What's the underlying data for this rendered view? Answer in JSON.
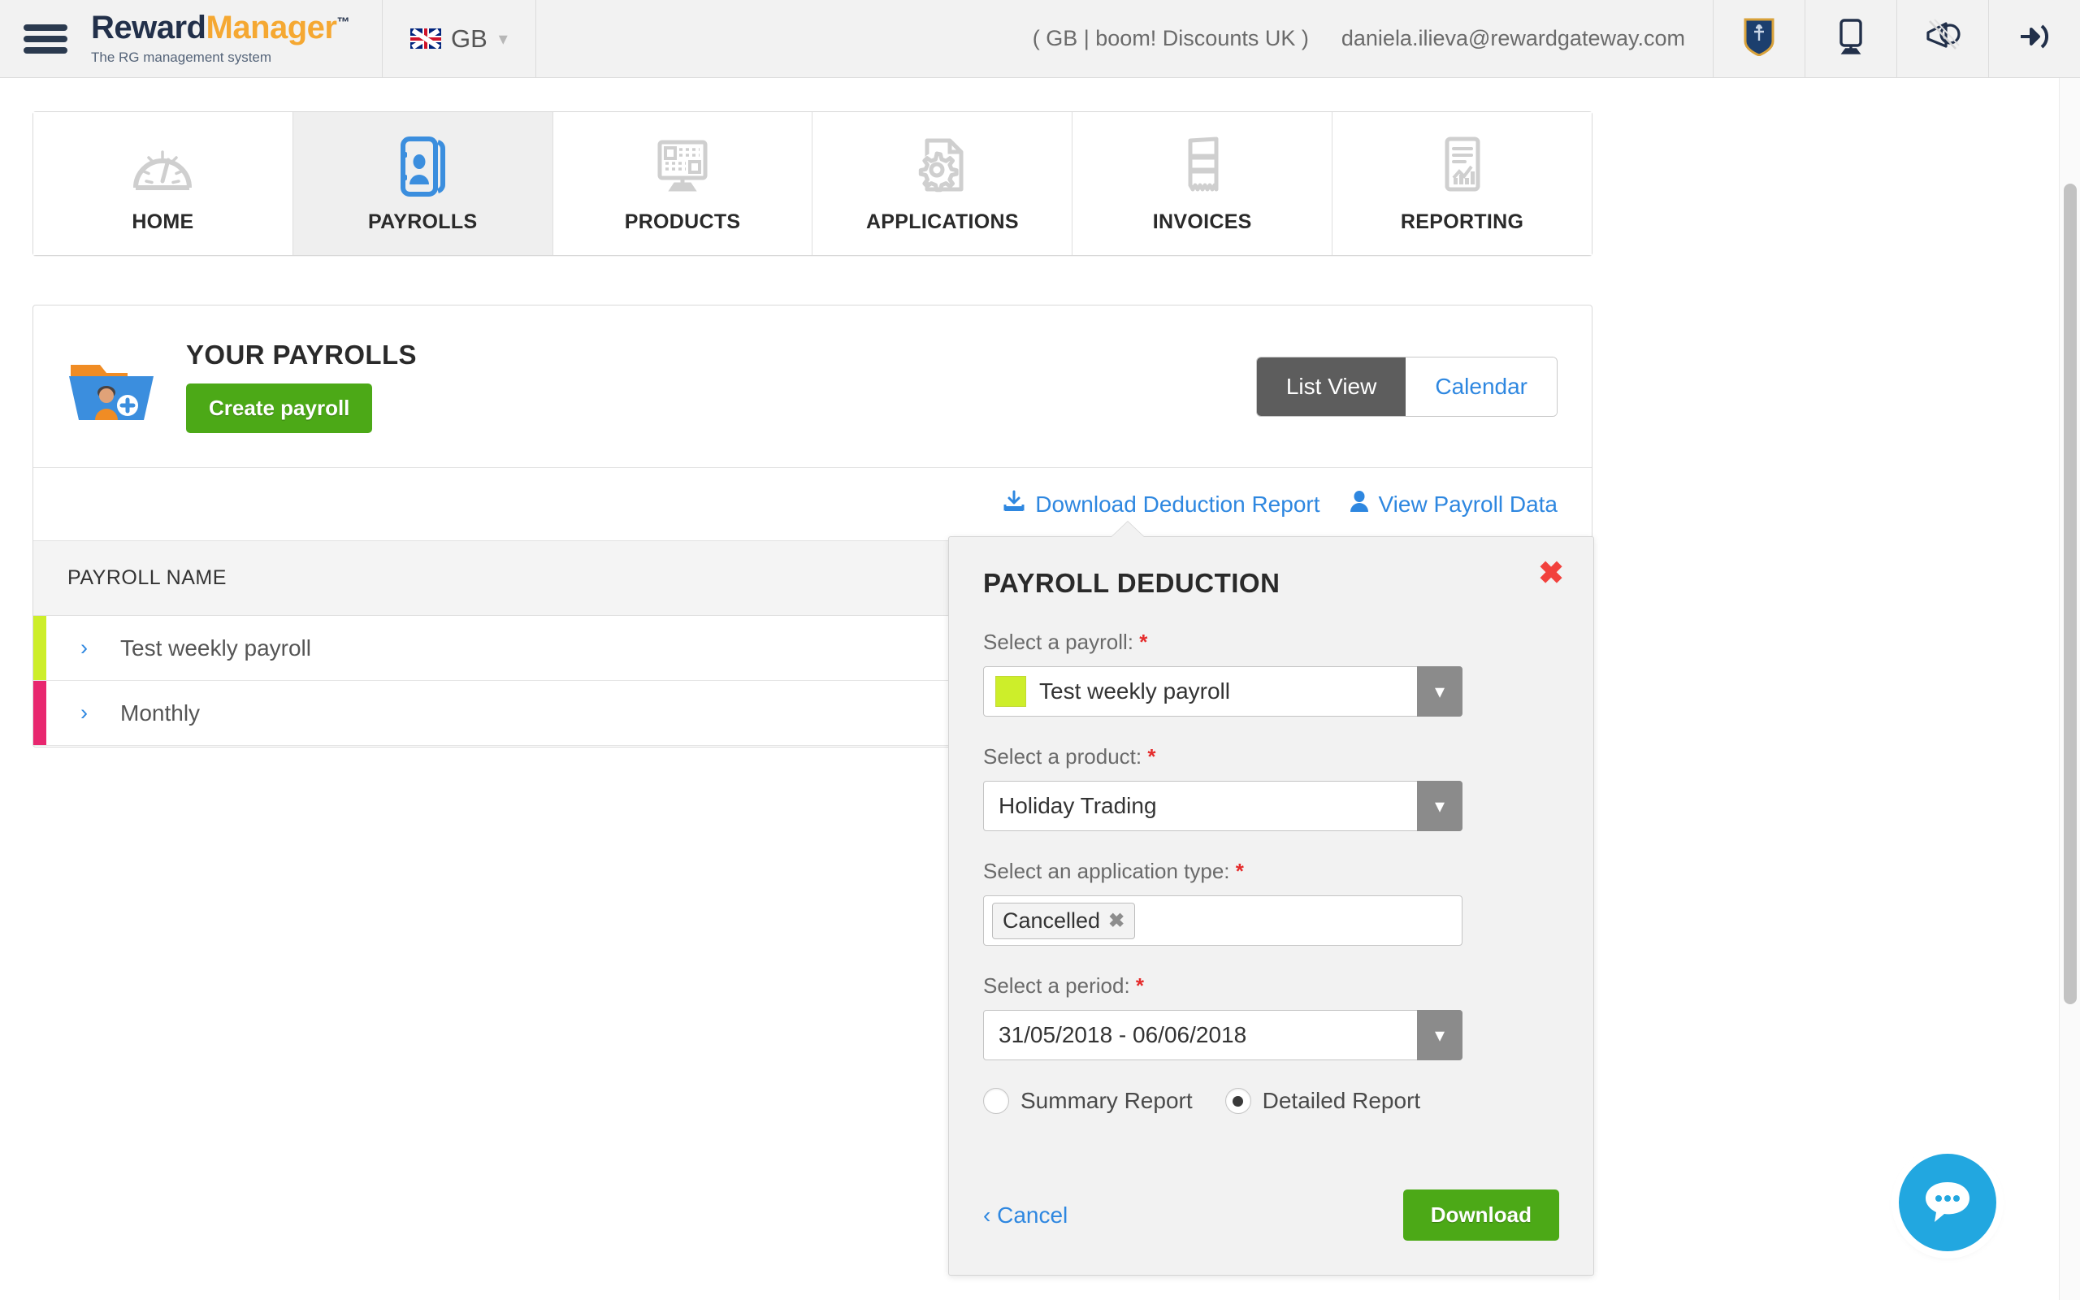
{
  "header": {
    "menu_icon": "hamburger-icon",
    "brand_part1": "Reward",
    "brand_part2": "Manager",
    "brand_tm": "™",
    "brand_tagline": "The RG management system",
    "locale_label": "GB",
    "locale_flag": "uk-flag-icon",
    "context": "( GB | boom! Discounts UK )",
    "user_email": "daniela.ilieva@rewardgateway.com",
    "icons": [
      {
        "name": "shield-icon"
      },
      {
        "name": "monitor-icon"
      },
      {
        "name": "megaphone-icon"
      },
      {
        "name": "logout-icon"
      }
    ]
  },
  "nav": {
    "tabs": [
      {
        "label": "HOME",
        "icon": "speedometer-icon",
        "active": false
      },
      {
        "label": "PAYROLLS",
        "icon": "id-card-icon",
        "active": true
      },
      {
        "label": "PRODUCTS",
        "icon": "monitor-grid-icon",
        "active": false
      },
      {
        "label": "APPLICATIONS",
        "icon": "gear-document-icon",
        "active": false
      },
      {
        "label": "INVOICES",
        "icon": "receipt-icon",
        "active": false
      },
      {
        "label": "REPORTING",
        "icon": "report-chart-icon",
        "active": false
      }
    ]
  },
  "payrolls_card": {
    "folder_icon": "folder-user-icon",
    "title": "YOUR PAYROLLS",
    "create_button": "Create payroll",
    "view_toggle": {
      "list_view": "List View",
      "calendar": "Calendar",
      "selected": "List View"
    },
    "links": [
      {
        "label": "Download Deduction Report",
        "icon": "download-icon"
      },
      {
        "label": "View Payroll Data",
        "icon": "person-icon"
      }
    ],
    "table": {
      "columns": [
        "PAYROLL NAME"
      ],
      "rows": [
        {
          "name": "Test weekly payroll",
          "color": "#cdee2a",
          "chevron": "›"
        },
        {
          "name": "Monthly",
          "color": "#e8276f",
          "chevron": "›"
        }
      ]
    }
  },
  "popover": {
    "title": "PAYROLL DEDUCTION",
    "close_icon": "close-icon",
    "fields": {
      "payroll": {
        "label": "Select a payroll:",
        "required": "*",
        "value": "Test weekly payroll",
        "swatch_color": "#cdee2a"
      },
      "product": {
        "label": "Select a product:",
        "required": "*",
        "value": "Holiday Trading"
      },
      "application_type": {
        "label": "Select an application type:",
        "required": "*",
        "tags": [
          "Cancelled"
        ]
      },
      "period": {
        "label": "Select a period:",
        "required": "*",
        "value": "31/05/2018 - 06/06/2018"
      }
    },
    "report_type": {
      "options": [
        {
          "label": "Summary Report",
          "selected": false
        },
        {
          "label": "Detailed Report",
          "selected": true
        }
      ]
    },
    "cancel_label": "Cancel",
    "cancel_chevron": "‹",
    "download_label": "Download"
  },
  "chat": {
    "icon": "chat-bubble-icon"
  },
  "colors": {
    "brand_orange": "#f5a832",
    "brand_navy": "#22304a",
    "link_blue": "#2e87e0",
    "green": "#4ca917",
    "red": "#f2413d",
    "chat_blue": "#22a7e0"
  }
}
